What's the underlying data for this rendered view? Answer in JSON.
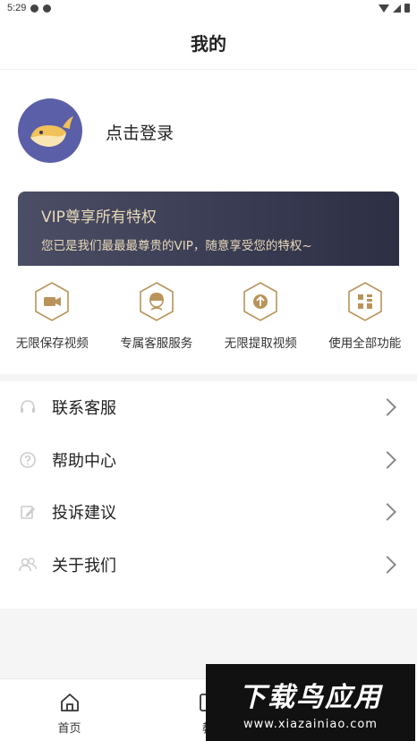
{
  "status_bar": {
    "time": "5:29"
  },
  "header": {
    "title": "我的"
  },
  "profile": {
    "login_label": "点击登录"
  },
  "vip": {
    "title": "VIP尊享所有特权",
    "subtitle": "您已是我们最最最尊贵的VIP，随意享受您的特权~"
  },
  "perks": [
    {
      "label": "无限保存视频",
      "icon": "video-camera-icon"
    },
    {
      "label": "专属客服服务",
      "icon": "customer-service-icon"
    },
    {
      "label": "无限提取视频",
      "icon": "upload-arrow-icon"
    },
    {
      "label": "使用全部功能",
      "icon": "grid-apps-icon"
    }
  ],
  "menu": [
    {
      "label": "联系客服",
      "icon": "headset-icon"
    },
    {
      "label": "帮助中心",
      "icon": "question-icon"
    },
    {
      "label": "投诉建议",
      "icon": "edit-icon"
    },
    {
      "label": "关于我们",
      "icon": "users-icon"
    }
  ],
  "tabs": [
    {
      "label": "首页",
      "icon": "home-icon"
    },
    {
      "label": "教",
      "icon": "book-icon"
    }
  ],
  "watermark": {
    "title": "下载鸟应用",
    "url": "www.xiazainiao.com"
  },
  "colors": {
    "vip_gold": "#e8d9b8",
    "vip_bg": "#3b3e55",
    "perk_gold": "#b9935a",
    "avatar_bg": "#5b5fa8"
  }
}
